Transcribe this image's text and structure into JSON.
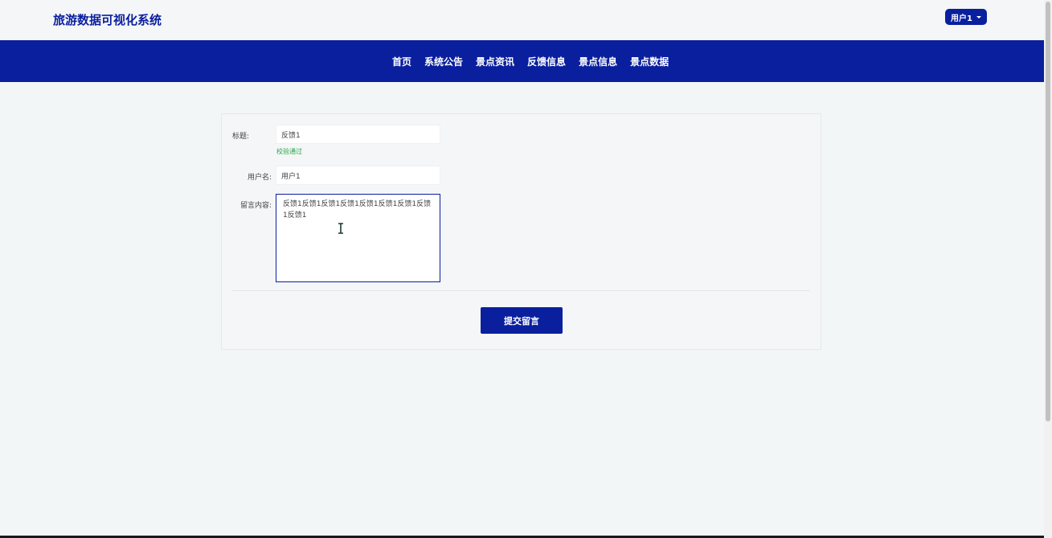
{
  "header": {
    "brand": "旅游数据可视化系统",
    "user_label": "用户1"
  },
  "nav": {
    "items": [
      "首页",
      "系统公告",
      "景点资讯",
      "反馈信息",
      "景点信息",
      "景点数据"
    ]
  },
  "form": {
    "title_label": "标题:",
    "title_value": "反馈1",
    "title_hint": "校验通过",
    "username_label": "用户名:",
    "username_value": "用户1",
    "content_label": "留言内容:",
    "content_value": "反馈1反馈1反馈1反馈1反馈1反馈1反馈1反馈1反馈1",
    "submit_label": "提交留言"
  },
  "colors": {
    "primary": "#0a1f9e",
    "success": "#28a745",
    "background": "#f3f6f7"
  }
}
